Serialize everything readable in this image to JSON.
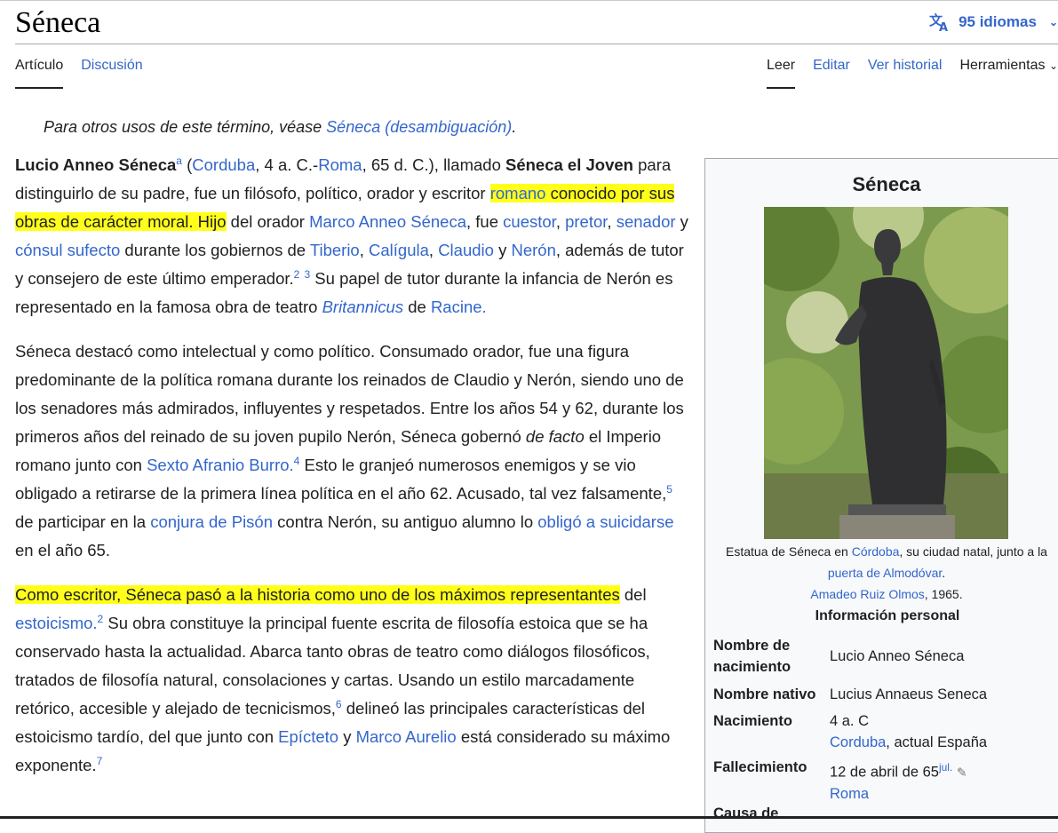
{
  "page": {
    "title": "Séneca"
  },
  "header": {
    "languages_label": "95 idiomas"
  },
  "tabs": {
    "left": [
      {
        "label": "Artículo"
      },
      {
        "label": "Discusión"
      }
    ],
    "right": [
      {
        "label": "Leer"
      },
      {
        "label": "Editar"
      },
      {
        "label": "Ver historial"
      },
      {
        "label": "Herramientas"
      }
    ]
  },
  "hatnote": {
    "prefix": "Para otros usos de este término, véase ",
    "link": "Séneca (desambiguación)",
    "suffix": "."
  },
  "p1": {
    "name": "Lucio Anneo Séneca",
    "note_a": "a",
    "t1": " (",
    "l_corduba": "Corduba",
    "t2": ", 4 a. C.-",
    "l_roma": "Roma",
    "t3": ", 65 d. C.), llamado ",
    "b2": "Séneca el Joven",
    "t4": " para distinguirlo de su padre, fue un filósofo, político, orador y escritor ",
    "l_romano": "romano",
    "t5": " conocido por sus obras de carácter moral. Hijo",
    "t6": " del orador ",
    "l_marco": "Marco Anneo Séneca",
    "t7": ", fue ",
    "l_cuestor": "cuestor",
    "t8": ", ",
    "l_pretor": "pretor",
    "t9": ", ",
    "l_senador": "senador",
    "t10": " y ",
    "l_consul": "cónsul sufecto",
    "t11": " durante los gobiernos de ",
    "l_tiberio": "Tiberio",
    "t12": ", ",
    "l_caligula": "Calígula",
    "t13": ", ",
    "l_claudio": "Claudio",
    "t14": " y ",
    "l_neron": "Nerón",
    "t15": ", además de tutor y consejero de este último emperador.",
    "ref_2": "2",
    "ref_3": "3",
    "t16": " Su papel de tutor durante la infancia de Nerón es representado en la famosa obra de teatro ",
    "l_brit": "Britannicus",
    "t17": " de ",
    "l_racine": "Racine."
  },
  "p2": {
    "t1": "Séneca destacó como intelectual y como político. Consumado orador, fue una figura predominante de la política romana durante los reinados de Claudio y Nerón, siendo uno de los senadores más admirados, influyentes y respetados. Entre los años 54 y 62, durante los primeros años del reinado de su joven pupilo Nerón, Séneca gobernó ",
    "i1": "de facto",
    "t2": " el Imperio romano junto con ",
    "l_burro": "Sexto Afranio Burro.",
    "ref_4": "4",
    "t3": " Esto le granjeó numerosos enemigos y se vio obligado a retirarse de la primera línea política en el año 62. Acusado, tal vez falsamente,",
    "ref_5": "5",
    "t4": " de participar en la ",
    "l_conjura": "conjura de Pisón",
    "t5": " contra Nerón, su antiguo alumno lo ",
    "l_obligo": "obligó a suicidarse",
    "t6": " en el año 65."
  },
  "p3": {
    "hl": "Como escritor, Séneca pasó a la historia como uno de los máximos representantes",
    "t1": " del ",
    "l_estoicismo": "estoicismo.",
    "ref_2": "2",
    "t2": " Su obra constituye la principal fuente escrita de filosofía estoica que se ha conservado hasta la actualidad. Abarca tanto obras de teatro como diálogos filosóficos, tratados de filosofía natural, consolaciones y cartas. Usando un estilo marcadamente retórico, accesible y alejado de tecnicismos,",
    "ref_6": "6",
    "t3": " delineó las principales características del estoicismo tardío, del que junto con ",
    "l_epicteto": "Epícteto",
    "t4": " y ",
    "l_marco_aurelio": "Marco Aurelio",
    "t5": " está considerado su máximo exponente.",
    "ref_7": "7"
  },
  "infobox": {
    "title": "Séneca",
    "caption": {
      "t1": "Estatua de Séneca en ",
      "l_cordoba": "Córdoba",
      "t2": ", su ciudad natal, junto a la ",
      "l_puerta": "puerta de Almodóvar",
      "t3": ".",
      "l_amadeo": "Amadeo Ruiz Olmos",
      "t4": ", 1965."
    },
    "section": "Información personal",
    "rows": [
      {
        "label": "Nombre de nacimiento",
        "value": "Lucio Anneo Séneca"
      },
      {
        "label": "Nombre nativo",
        "value": "Lucius Annaeus Seneca"
      },
      {
        "label": "Nacimiento",
        "value": "4 a. C",
        "link": "Corduba",
        "rest": ", actual España"
      },
      {
        "label": "Fallecimiento",
        "value": "12 de abril de 65",
        "sup": "jul.",
        "link": "Roma"
      },
      {
        "label": "Causa de"
      }
    ]
  }
}
